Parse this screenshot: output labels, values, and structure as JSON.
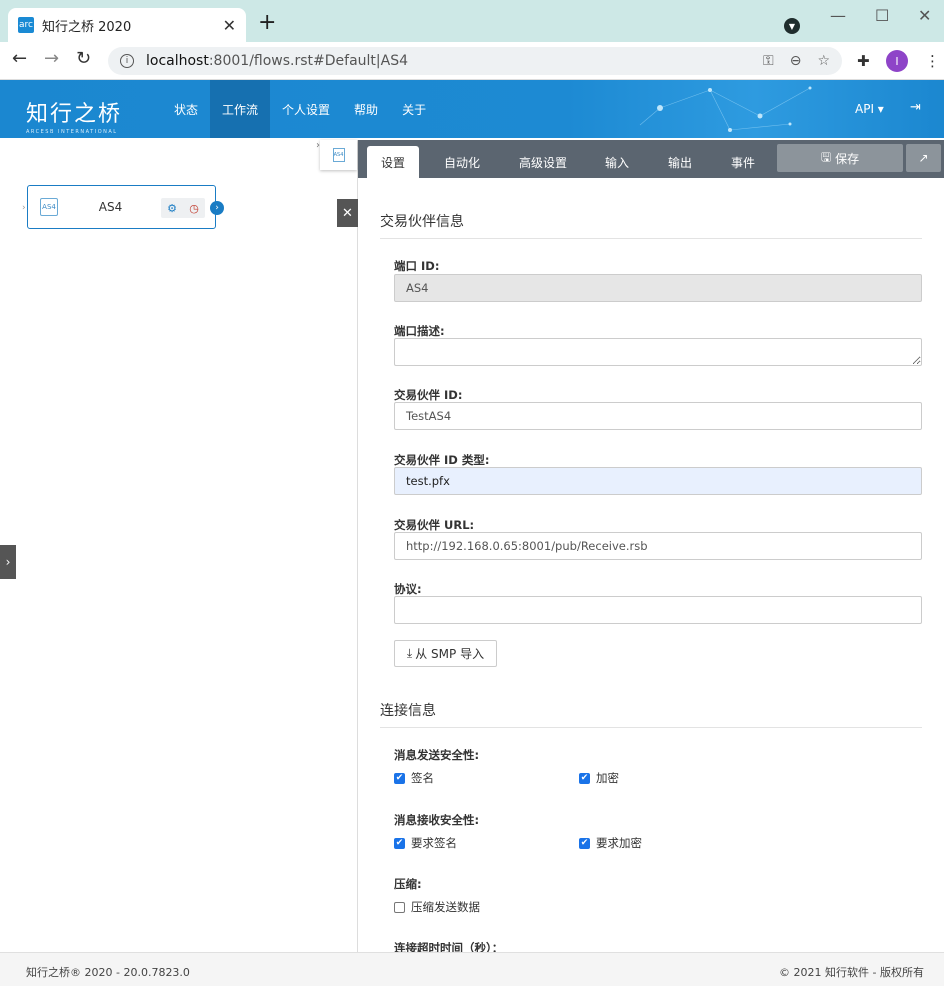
{
  "browser": {
    "tab_title": "知行之桥 2020",
    "favicon_text": "arc",
    "url_host": "localhost",
    "url_rest": ":8001/flows.rst#Default|AS4",
    "avatar_letter": "I"
  },
  "header": {
    "logo": "知行之桥",
    "logo_sub": "ARCESB INTERNATIONAL",
    "nav": [
      "状态",
      "工作流",
      "个人设置",
      "帮助",
      "关于"
    ],
    "active_nav": "工作流",
    "api_label": "API"
  },
  "canvas": {
    "node_label": "AS4",
    "mini_node_text": "AS4",
    "node_icon_text": "AS4"
  },
  "panel": {
    "tabs": [
      "设置",
      "自动化",
      "高级设置",
      "输入",
      "输出",
      "事件"
    ],
    "active_tab": "设置",
    "save_label": "保存",
    "section_partner": "交易伙伴信息",
    "port_id_label": "端口 ID:",
    "port_id_value": "AS4",
    "port_desc_label": "端口描述:",
    "partner_id_label": "交易伙伴 ID:",
    "partner_id_value": "TestAS4",
    "partner_id_type_label": "交易伙伴 ID 类型:",
    "partner_id_type_value": "test.pfx",
    "partner_url_label": "交易伙伴 URL:",
    "partner_url_value": "http://192.168.0.65:8001/pub/Receive.rsb",
    "protocol_label": "协议:",
    "smp_button": "从 SMP 导入",
    "section_connection": "连接信息",
    "send_security_label": "消息发送安全性:",
    "sign_label": "签名",
    "encrypt_label": "加密",
    "receive_security_label": "消息接收安全性:",
    "require_sign_label": "要求签名",
    "require_encrypt_label": "要求加密",
    "compression_label": "压缩:",
    "compress_send_label": "压缩发送数据",
    "timeout_label": "连接超时时间（秒）："
  },
  "footer": {
    "left": "知行之桥® 2020 - 20.0.7823.0",
    "right": "© 2021 知行软件 - 版权所有"
  }
}
